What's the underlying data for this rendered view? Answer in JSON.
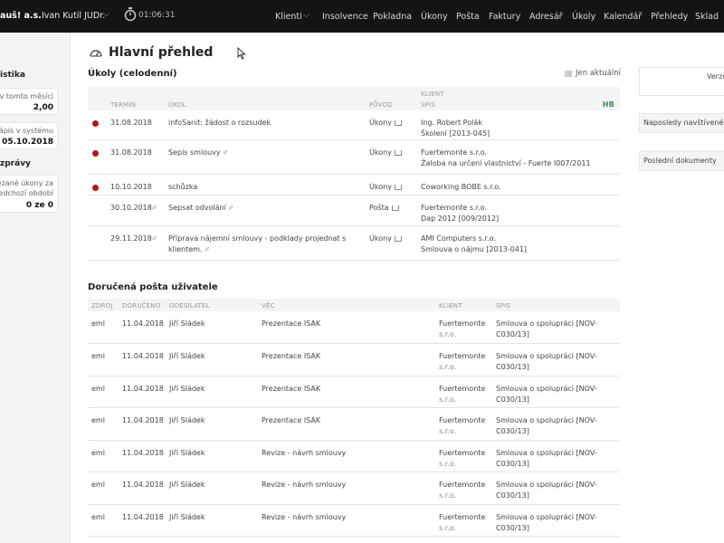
{
  "topbar": {
    "firm": "auš! a.s.",
    "user": "Ivan Kutil JUDr.",
    "timer": "01:06:31",
    "nav": [
      "Klienti",
      "Insolvence",
      "Pokladna",
      "Úkony",
      "Pošta",
      "Faktury",
      "Adresář",
      "Úkoly",
      "Kalendář",
      "Přehledy",
      "Sklad"
    ]
  },
  "sidebar": {
    "stats_heading": "istika",
    "card1": {
      "label": "v tomto měsíci",
      "value": "2,00"
    },
    "card2": {
      "label": "rápis v systému",
      "value": "05.10.2018"
    },
    "msgs_heading": "zprávy",
    "card3": {
      "label1": "ězané úkony za",
      "label2": "edchozí období",
      "value": "0 ze 0"
    }
  },
  "page": {
    "title": "Hlavní přehled"
  },
  "tasks": {
    "title": "Úkoly (celodenní)",
    "filter_label": "Jen aktuální",
    "columns": {
      "client_top": "Klient",
      "termin": "Termín",
      "ukol": "Úkol",
      "puvod": "Původ",
      "spis": "Spis",
      "hb": "HB"
    },
    "rows": [
      {
        "dot": true,
        "termin": "31.08.2018",
        "ukol": "infoSanit: žádost o rozsudek",
        "ukol2": "",
        "edit": false,
        "puvod": "Úkony",
        "client1": "Ing. Robert Polák",
        "client2": "Školení [2013-045]"
      },
      {
        "dot": true,
        "termin": "31.08.2018",
        "ukol": "Sepis smlouvy",
        "ukol2": "",
        "edit": true,
        "puvod": "Úkony",
        "client1": "Fuertemonte s.r.o.",
        "client2": "Žaloba na určení vlastnictví - Fuerte I007/2011"
      },
      {
        "dot": true,
        "termin": "10.10.2018",
        "ukol": "schůzka",
        "ukol2": "",
        "edit": false,
        "puvod": "Úkony",
        "client1": "Coworking BOBE s.r.o.",
        "client2": ""
      },
      {
        "dot": false,
        "termin": "30.10.2018",
        "ukol": "Sepsat odvolání",
        "ukol2": "",
        "edit": true,
        "puvod": "Pošta",
        "client1": "Fuertemonte s.r.o.",
        "client2": "Dap 2012 [009/2012]"
      },
      {
        "dot": false,
        "termin": "29.11.2018",
        "ukol": "Příprava nájemní smlouvy - podklady projednat s",
        "ukol2": "klientem.",
        "edit": true,
        "puvod": "Úkony",
        "client1": "AMI Computers s.r.o.",
        "client2": "Smlouva o nájmu [2013-041]"
      }
    ]
  },
  "mail": {
    "title": "Doručená pošta uživatele",
    "columns": {
      "zdroj": "Zdroj",
      "doruceno": "Doručeno",
      "odesilatel": "Odesílatel",
      "vec": "Věc",
      "klient": "Klient",
      "spis": "Spis"
    },
    "rows": [
      {
        "zdroj": "eml",
        "doruceno": "11.04.2018",
        "odesilatel": "Jiří Sládek",
        "vec": "Prezentace ISAK",
        "klient1": "Fuertemonte",
        "klient2": "s.r.o.",
        "spis1": "Smlouva o spolupráci [NOV-",
        "spis2": "C030/13]"
      },
      {
        "zdroj": "eml",
        "doruceno": "11.04.2018",
        "odesilatel": "Jiří Sládek",
        "vec": "Prezentace ISAK",
        "klient1": "Fuertemonte",
        "klient2": "s.r.o.",
        "spis1": "Smlouva o spolupráci [NOV-",
        "spis2": "C030/13]"
      },
      {
        "zdroj": "eml",
        "doruceno": "11.04.2018",
        "odesilatel": "Jiří Sládek",
        "vec": "Prezentace ISAK",
        "klient1": "Fuertemonte",
        "klient2": "s.r.o.",
        "spis1": "Smlouva o spolupráci [NOV-",
        "spis2": "C030/13]"
      },
      {
        "zdroj": "eml",
        "doruceno": "11.04.2018",
        "odesilatel": "Jiří Sládek",
        "vec": "Prezentace ISAK",
        "klient1": "Fuertemonte",
        "klient2": "s.r.o.",
        "spis1": "Smlouva o spolupráci [NOV-",
        "spis2": "C030/13]"
      },
      {
        "zdroj": "eml",
        "doruceno": "11.04.2018",
        "odesilatel": "Jiří Sládek",
        "vec": "Revize - návrh smlouvy",
        "klient1": "Fuertemonte",
        "klient2": "s.r.o.",
        "spis1": "Smlouva o spolupráci [NOV-",
        "spis2": "C030/13]"
      },
      {
        "zdroj": "eml",
        "doruceno": "11.04.2018",
        "odesilatel": "Jiří Sládek",
        "vec": "Revize - návrh smlouvy",
        "klient1": "Fuertemonte",
        "klient2": "s.r.o.",
        "spis1": "Smlouva o spolupráci [NOV-",
        "spis2": "C030/13]"
      },
      {
        "zdroj": "eml",
        "doruceno": "11.04.2018",
        "odesilatel": "Jiří Sládek",
        "vec": "Revize - návrh smlouvy",
        "klient1": "Fuertemonte",
        "klient2": "s.r.o.",
        "spis1": "Smlouva o spolupráci [NOV-",
        "spis2": "C030/13]"
      }
    ]
  },
  "rightcol": {
    "box1": "Verze",
    "box2": "Naposledy navštívené s",
    "box3": "Poslední dokumenty"
  },
  "colors": {
    "topbar_bg": "#141414",
    "urgent_dot": "#c0101a",
    "hb_green": "#3b8c50"
  }
}
